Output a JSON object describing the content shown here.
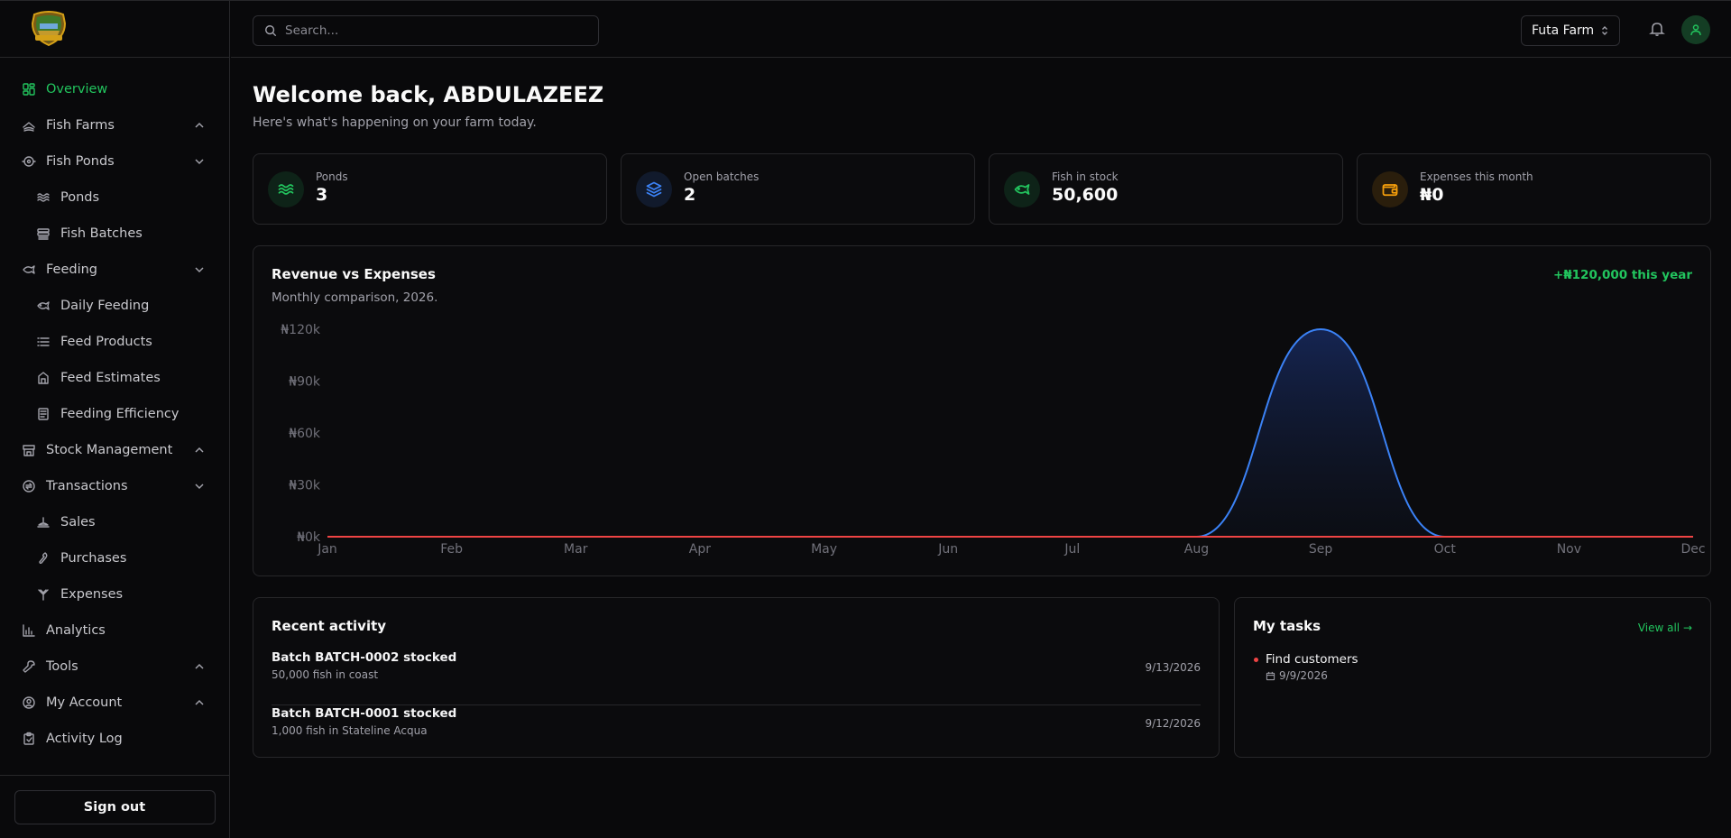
{
  "sidebar": {
    "items": [
      {
        "label": "Overview",
        "icon": "dashboard-icon",
        "active": true
      },
      {
        "label": "Fish Farms",
        "icon": "fish-farm-icon",
        "chevron": "up"
      },
      {
        "label": "Fish Ponds",
        "icon": "fish-pond-icon",
        "chevron": "down"
      },
      {
        "label": "Ponds",
        "icon": "waves-icon",
        "sub": true
      },
      {
        "label": "Fish Batches",
        "icon": "batches-icon",
        "sub": true
      },
      {
        "label": "Feeding",
        "icon": "feeding-icon",
        "chevron": "down"
      },
      {
        "label": "Daily Feeding",
        "icon": "fish-icon",
        "sub": true
      },
      {
        "label": "Feed Products",
        "icon": "list-icon",
        "sub": true
      },
      {
        "label": "Feed Estimates",
        "icon": "estimate-icon",
        "sub": true
      },
      {
        "label": "Feeding Efficiency",
        "icon": "efficiency-icon",
        "sub": true
      },
      {
        "label": "Stock Management",
        "icon": "store-icon",
        "chevron": "up"
      },
      {
        "label": "Transactions",
        "icon": "transactions-icon",
        "chevron": "down"
      },
      {
        "label": "Sales",
        "icon": "sales-icon",
        "sub": true
      },
      {
        "label": "Purchases",
        "icon": "purchases-icon",
        "sub": true
      },
      {
        "label": "Expenses",
        "icon": "expenses-icon",
        "sub": true
      },
      {
        "label": "Analytics",
        "icon": "analytics-icon"
      },
      {
        "label": "Tools",
        "icon": "wrench-icon",
        "chevron": "up"
      },
      {
        "label": "My Account",
        "icon": "account-icon",
        "chevron": "up"
      },
      {
        "label": "Activity Log",
        "icon": "clipboard-icon"
      }
    ],
    "signout_label": "Sign out"
  },
  "header": {
    "search_placeholder": "Search...",
    "farm_name": "Futa Farm"
  },
  "main": {
    "welcome": "Welcome back, ABDULAZEEZ",
    "subtitle": "Here's what's happening on your farm today.",
    "stats": [
      {
        "label": "Ponds",
        "value": "3",
        "icon": "waves-icon",
        "color": "#22c55e"
      },
      {
        "label": "Open batches",
        "value": "2",
        "icon": "layers-icon",
        "color": "#3b82f6"
      },
      {
        "label": "Fish in stock",
        "value": "50,600",
        "icon": "fish-icon",
        "color": "#22c55e"
      },
      {
        "label": "Expenses this month",
        "value": "₦0",
        "icon": "wallet-icon",
        "color": "#f59e0b"
      }
    ],
    "chart_card": {
      "title": "Revenue vs Expenses",
      "subtitle": "Monthly comparison, 2026.",
      "badge": "+₦120,000 this year"
    },
    "activity": {
      "title": "Recent activity",
      "items": [
        {
          "title": "Batch BATCH-0002 stocked",
          "desc": "50,000 fish in coast",
          "date": "9/13/2026"
        },
        {
          "title": "Batch BATCH-0001 stocked",
          "desc": "1,000 fish in Stateline Acqua",
          "date": "9/12/2026"
        }
      ]
    },
    "tasks": {
      "title": "My tasks",
      "view_all": "View all →",
      "items": [
        {
          "title": "Find customers",
          "date": "9/9/2026"
        }
      ]
    }
  },
  "chart_data": {
    "type": "area",
    "categories": [
      "Jan",
      "Feb",
      "Mar",
      "Apr",
      "May",
      "Jun",
      "Jul",
      "Aug",
      "Sep",
      "Oct",
      "Nov",
      "Dec"
    ],
    "y_ticks": [
      "₦0k",
      "₦30k",
      "₦60k",
      "₦90k",
      "₦120k"
    ],
    "ylim": [
      0,
      120000
    ],
    "series": [
      {
        "values": [
          0,
          0,
          0,
          0,
          0,
          0,
          0,
          0,
          120000,
          0,
          0,
          0
        ],
        "color": "#3b82f6"
      },
      {
        "values": [
          0,
          0,
          0,
          0,
          0,
          0,
          0,
          0,
          0,
          0,
          0,
          0
        ],
        "color": "#ef4444"
      }
    ]
  }
}
